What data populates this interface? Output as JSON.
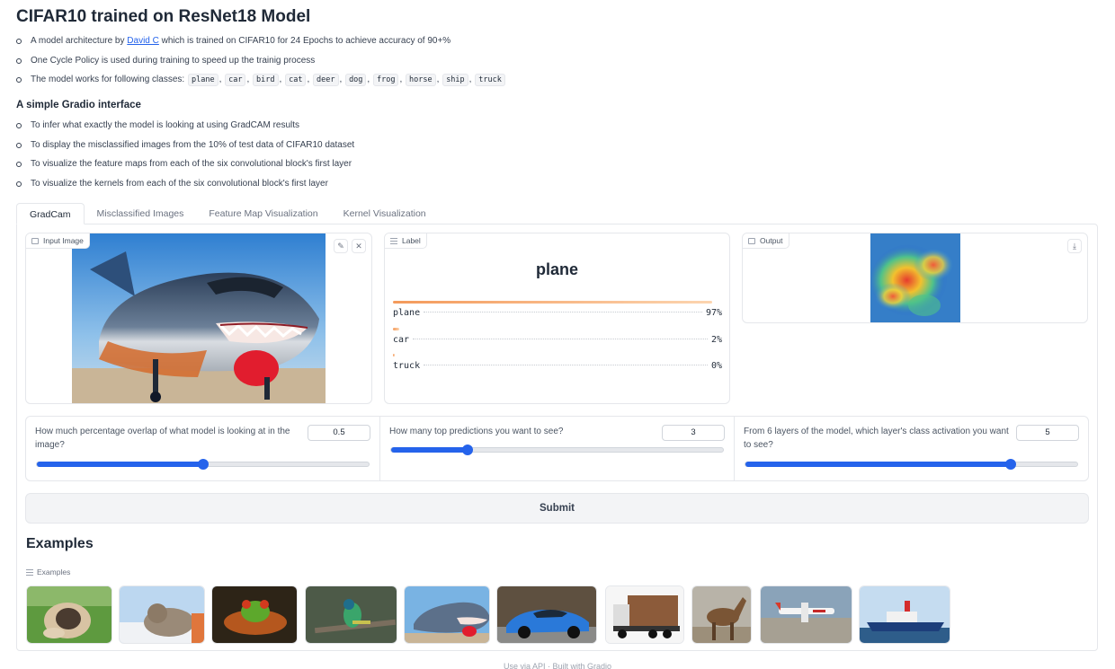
{
  "header": {
    "title": "CIFAR10 trained on ResNet18 Model",
    "bullet1_pre": "A model architecture by ",
    "bullet1_link": "David C",
    "bullet1_post": " which is trained on CIFAR10 for 24 Epochs to achieve accuracy of 90+%",
    "bullet2": "One Cycle Policy is used during training to speed up the trainig process",
    "bullet3_pre": "The model works for following classes: ",
    "classes": [
      "plane",
      "car",
      "bird",
      "cat",
      "deer",
      "dog",
      "frog",
      "horse",
      "ship",
      "truck"
    ],
    "subheading": "A simple Gradio interface",
    "features": [
      "To infer what exactly the model is looking at using GradCAM results",
      "To display the misclassified images from the 10% of test data of CIFAR10 dataset",
      "To visualize the feature maps from each of the six convolutional block's first layer",
      "To visualize the kernels from each of the six convolutional block's first layer"
    ]
  },
  "tabs": [
    "GradCam",
    "Misclassified Images",
    "Feature Map Visualization",
    "Kernel Visualization"
  ],
  "active_tab": "GradCam",
  "input_image": {
    "label": "Input Image",
    "edit_icon": "pencil-icon",
    "clear_icon": "close-icon"
  },
  "label_output": {
    "label": "Label",
    "top_class": "plane",
    "confidences": [
      {
        "name": "plane",
        "pct": "97%",
        "value": 0.97
      },
      {
        "name": "car",
        "pct": "2%",
        "value": 0.02
      },
      {
        "name": "truck",
        "pct": "0%",
        "value": 0.004
      }
    ]
  },
  "output": {
    "label": "Output",
    "download_icon": "download-icon"
  },
  "sliders": [
    {
      "label": "How much percentage overlap of what model is looking at in the image?",
      "value": "0.5",
      "fraction": 0.5
    },
    {
      "label": "How many top predictions you want to see?",
      "value": "3",
      "fraction": 0.23
    },
    {
      "label": "From 6 layers of the model, which layer's class activation you want to see?",
      "value": "5",
      "fraction": 0.8
    }
  ],
  "submit_label": "Submit",
  "examples": {
    "title": "Examples",
    "sub": "Examples",
    "thumbs": [
      "dog",
      "cat",
      "frog",
      "bird",
      "plane",
      "car",
      "truck",
      "horse",
      "plane",
      "ship"
    ]
  },
  "footer": "Use via API  ·  Built with Gradio",
  "colors": {
    "accent": "#2563eb",
    "confidence_bar": "#f49a5b"
  }
}
